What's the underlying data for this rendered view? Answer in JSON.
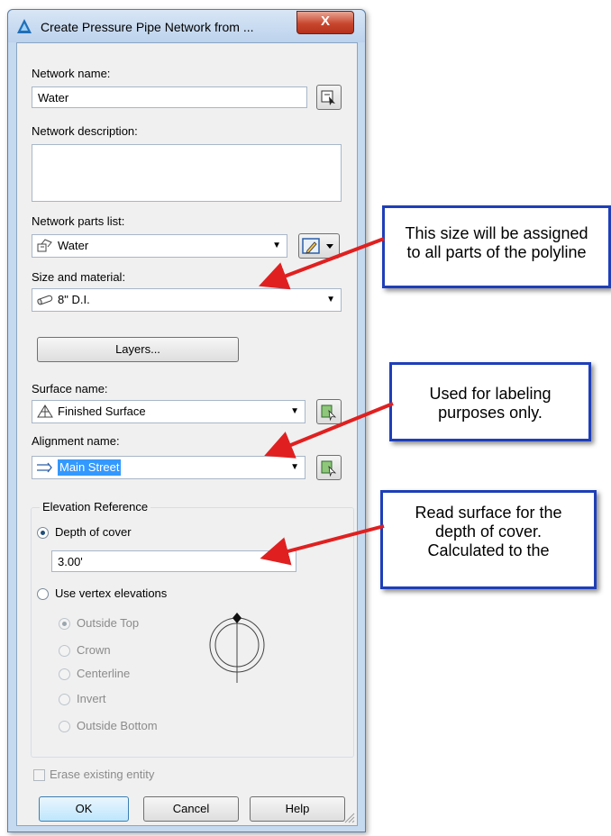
{
  "window": {
    "title": "Create Pressure Pipe Network from ...",
    "close_label": "X"
  },
  "form": {
    "network_name_label": "Network name:",
    "network_name_value": "Water",
    "network_description_label": "Network description:",
    "network_description_value": "",
    "parts_list_label": "Network parts list:",
    "parts_list_value": "Water",
    "size_material_label": "Size and material:",
    "size_material_value": "8\" D.I.",
    "layers_button": "Layers...",
    "surface_name_label": "Surface name:",
    "surface_name_value": "Finished Surface",
    "alignment_name_label": "Alignment name:",
    "alignment_name_value": "Main Street"
  },
  "elevation": {
    "group_title": "Elevation Reference",
    "depth_of_cover_label": "Depth of cover",
    "depth_of_cover_value": "3.00'",
    "use_vertex_label": "Use vertex elevations",
    "options": [
      "Outside Top",
      "Crown",
      "Centerline",
      "Invert",
      "Outside Bottom"
    ],
    "selected_option": "Outside Top",
    "selected_mode": "Depth of cover"
  },
  "erase_label": "Erase existing entity",
  "buttons": {
    "ok": "OK",
    "cancel": "Cancel",
    "help": "Help"
  },
  "callouts": {
    "size_lines": [
      "This size will be assigned",
      "to all parts of the polyline"
    ],
    "labeling_lines": [
      "Used for labeling",
      "purposes only."
    ],
    "surface_lines": [
      "Read surface for the",
      "depth of cover.",
      "Calculated to the"
    ]
  },
  "colors": {
    "callout_border": "#1e3fb8",
    "arrow": "#e02020",
    "close_button": "#c9472e",
    "selection": "#3399ff"
  }
}
